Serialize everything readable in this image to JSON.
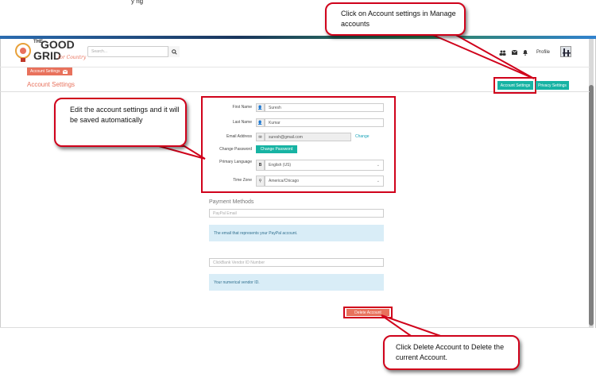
{
  "header": {
    "logo_text_the": "THE",
    "logo_text_good": "GOOD",
    "logo_text_grid": "GRID",
    "logo_tagline": "for Country",
    "search_placeholder": "Search...",
    "profile_label": "Profile"
  },
  "breadcrumb_button": "Account Settings",
  "page_title": "Account Settings",
  "tabs": {
    "account": "Account Settings",
    "privacy": "Privacy Settings"
  },
  "form": {
    "first_name_label": "First Name",
    "first_name_value": "Suresh",
    "last_name_label": "Last Name",
    "last_name_value": "Kumar",
    "email_label": "Email Address",
    "email_value": "suresh@gmail.com",
    "email_change": "Change",
    "password_label": "Change Password",
    "password_button": "Change Password",
    "language_label": "Primary Language",
    "language_value": "English (US)",
    "timezone_label": "Time Zone",
    "timezone_value": "America/Chicago"
  },
  "payment": {
    "title": "Payment Methods",
    "paypal_placeholder": "PayPal Email",
    "paypal_info": "The email that represents your PayPal account.",
    "vendor_placeholder": "ClickBank Vendor ID Number",
    "vendor_info": "Your numerical vendor ID."
  },
  "delete_button": "Delete Account",
  "callouts": {
    "top": "Click on Account settings in Manage accounts",
    "left": "Edit the account settings and it will be saved automatically",
    "bottom": "Click Delete Account to Delete the current Account."
  },
  "colors": {
    "accent_orange": "#e8715c",
    "accent_teal": "#17b3a3",
    "callout_red": "#d0021b",
    "info_bg": "#d9edf7"
  }
}
